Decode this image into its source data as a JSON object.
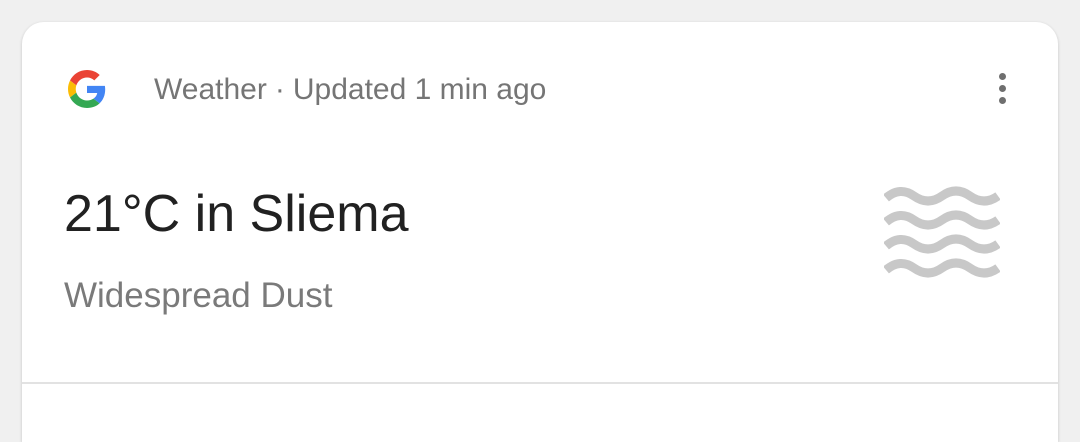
{
  "card": {
    "source_icon": "google-g-icon",
    "source_label": "Weather",
    "separator": "·",
    "updated_text": "Updated 1 min ago",
    "menu_icon": "more-vert-icon",
    "headline": "21°C in Sliema",
    "condition": "Widespread Dust",
    "condition_icon": "dust-haze-icon"
  },
  "colors": {
    "google_blue": "#4285F4",
    "google_red": "#EA4335",
    "google_yellow": "#FBBC05",
    "google_green": "#34A853",
    "icon_gray": "#c8c8c8"
  }
}
